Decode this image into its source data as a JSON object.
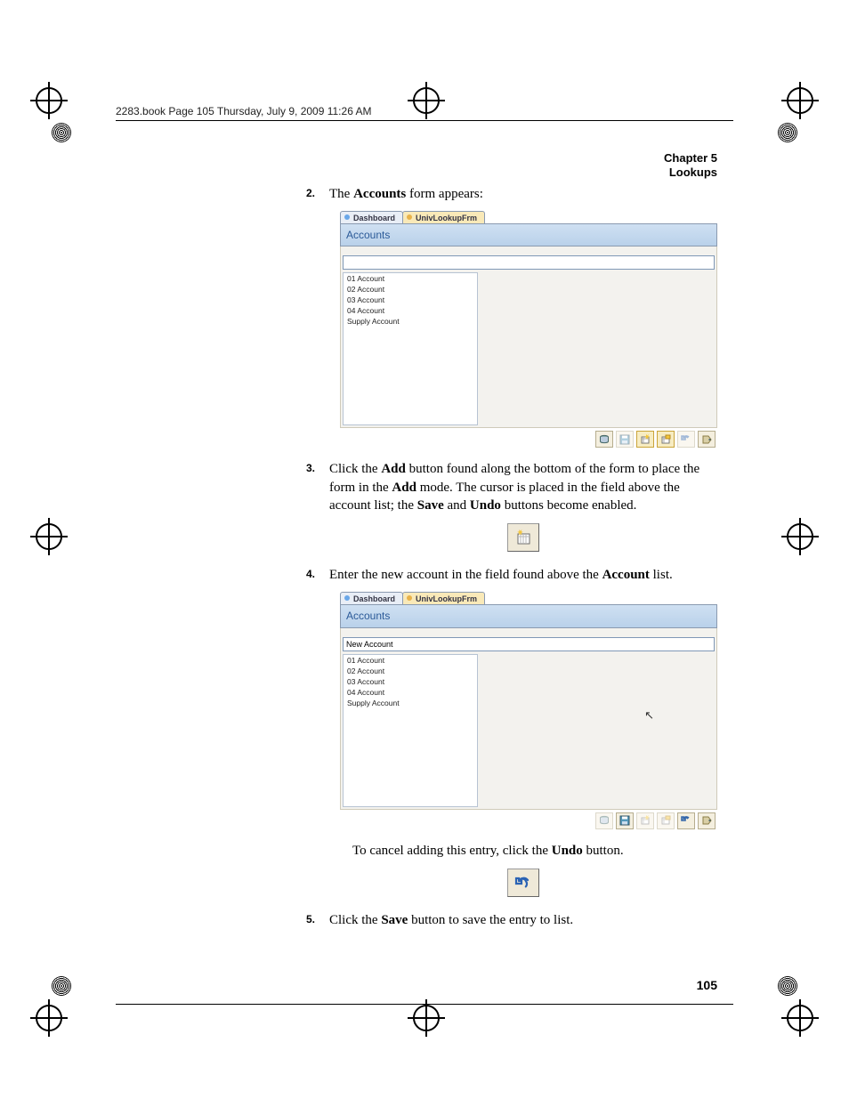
{
  "running_head": "2283.book  Page 105  Thursday, July 9, 2009  11:26 AM",
  "chapter_line1": "Chapter 5",
  "chapter_line2": "Lookups",
  "page_number": "105",
  "step2_prefix": "The ",
  "step2_bold": "Accounts",
  "step2_suffix": " form appears:",
  "step3_a": "Click the ",
  "step3_b": "Add",
  "step3_c": " button found along the bottom of the form to place the form in the ",
  "step3_d": "Add",
  "step3_e": " mode. The cursor is placed in the field above the account list; the ",
  "step3_f": "Save",
  "step3_g": " and ",
  "step3_h": "Undo",
  "step3_i": " buttons become enabled.",
  "step4_a": "Enter the new account in the field found above the ",
  "step4_b": "Account",
  "step4_c": " list.",
  "cancel_a": "To cancel adding this entry, click the ",
  "cancel_b": "Undo",
  "cancel_c": " button.",
  "step5_a": "Click the ",
  "step5_b": "Save",
  "step5_c": " button to save the entry to list.",
  "num2": "2.",
  "num3": "3.",
  "num4": "4.",
  "num5": "5.",
  "shot": {
    "tab_inactive": "Dashboard",
    "tab_active": "UnivLookupFrm",
    "title": "Accounts",
    "search_value_empty": "",
    "search_value_new": "New Account",
    "rows": [
      "01 Account",
      "02 Account",
      "03 Account",
      "04 Account",
      "Supply Account"
    ]
  }
}
